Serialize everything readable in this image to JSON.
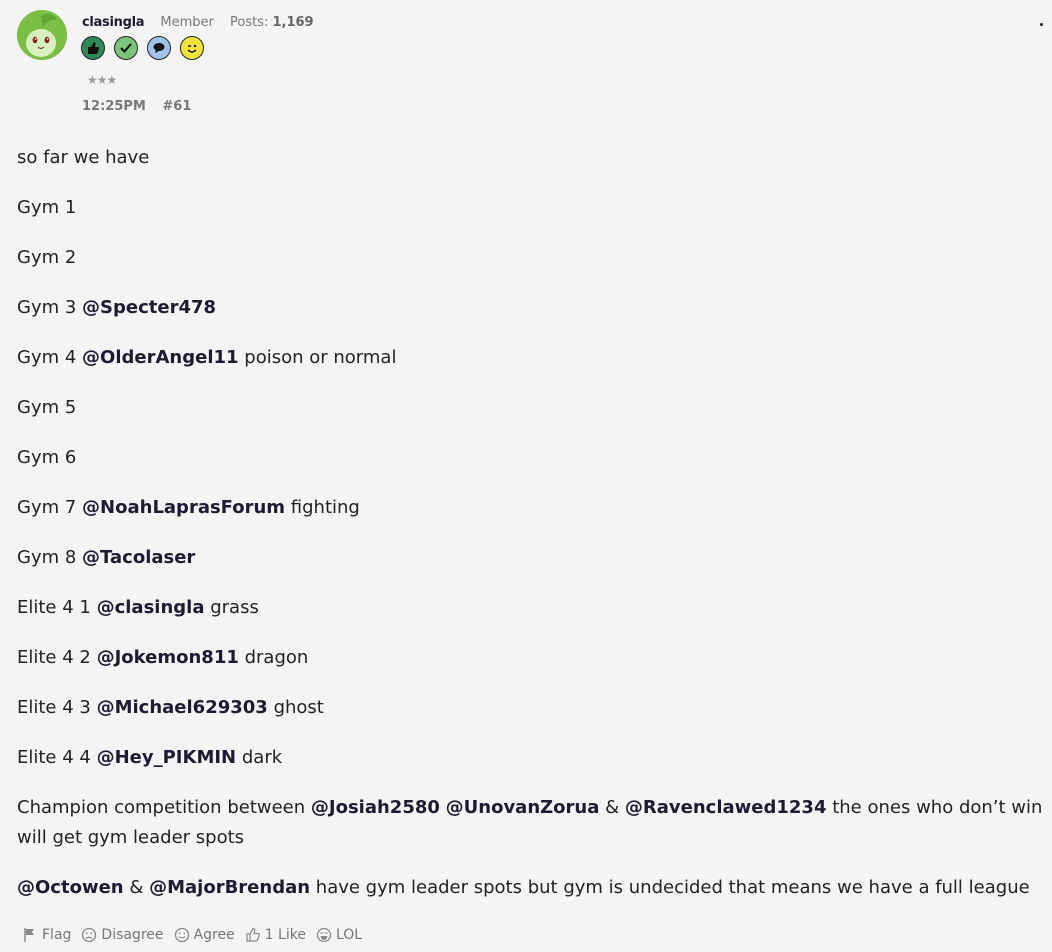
{
  "post": {
    "username": "clasingla",
    "role": "Member",
    "posts_label": "Posts:",
    "posts_count": "1,169",
    "stars": "★★★",
    "time": "12:25PM",
    "post_number": "#61",
    "badges": [
      {
        "icon": "thumbs-up-icon",
        "color": "#2e8b57"
      },
      {
        "icon": "checkmark-icon",
        "color": "#7cc47c"
      },
      {
        "icon": "speech-bubble-icon",
        "color": "#9fc4ea"
      },
      {
        "icon": "wink-face-icon",
        "color": "#f3e23c"
      }
    ]
  },
  "body": {
    "line1": "so far we have",
    "gym1": "Gym 1",
    "gym2": "Gym 2",
    "gym3": {
      "prefix": "Gym 3",
      "mention": "@Specter478",
      "suffix": ""
    },
    "gym4": {
      "prefix": "Gym 4",
      "mention": "@OlderAngel11",
      "suffix": "poison or normal"
    },
    "gym5": "Gym 5",
    "gym6": "Gym 6",
    "gym7": {
      "prefix": "Gym 7",
      "mention": "@NoahLaprasForum",
      "suffix": "fighting"
    },
    "gym8": {
      "prefix": "Gym 8",
      "mention": "@Tacolaser",
      "suffix": ""
    },
    "e1": {
      "prefix": "Elite 4 1",
      "mention": "@clasingla",
      "suffix": "grass"
    },
    "e2": {
      "prefix": "Elite 4 2",
      "mention": "@Jokemon811",
      "suffix": "dragon"
    },
    "e3": {
      "prefix": "Elite 4 3",
      "mention": "@Michael629303",
      "suffix": "ghost"
    },
    "e4": {
      "prefix": "Elite 4 4",
      "mention": "@Hey_PIKMIN",
      "suffix": "dark"
    },
    "champion": {
      "prefix": "Champion competition between",
      "m1": "@Josiah2580",
      "m2": "@UnovanZorua",
      "amp": "&",
      "m3": "@Ravenclawed1234",
      "suffix": "the ones who don’t win will get gym leader spots"
    },
    "last": {
      "m1": "@Octowen",
      "amp": "&",
      "m2": "@MajorBrendan",
      "suffix": "have gym leader spots but gym is undecided that means we have a full league"
    }
  },
  "actions": {
    "flag": "Flag",
    "disagree": "Disagree",
    "agree": "Agree",
    "like": "1 Like",
    "lol": "LOL"
  }
}
